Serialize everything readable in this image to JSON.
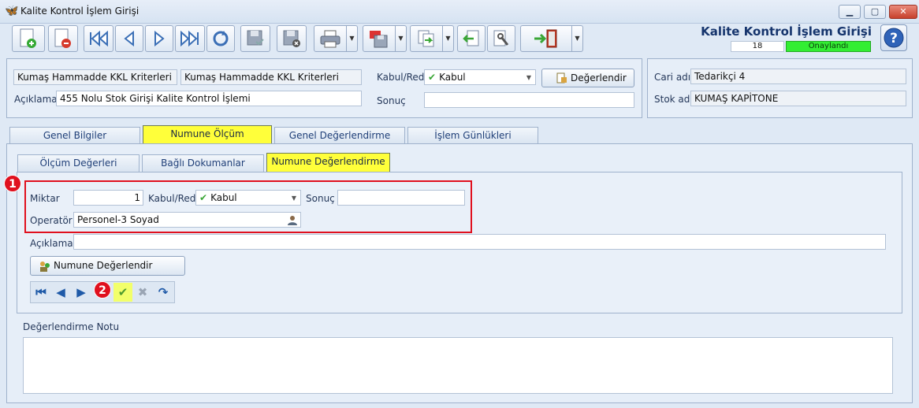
{
  "window": {
    "title": "Kalite Kontrol İşlem Girişi",
    "controls": {
      "minimize": "▁",
      "maximize": "▢",
      "close": "✕"
    }
  },
  "header": {
    "form_title": "Kalite Kontrol İşlem Girişi",
    "record_number": "18",
    "status": "Onaylandı",
    "help_label": "?"
  },
  "colors": {
    "active_tab": "#ffff3a",
    "status_badge": "#33ee33",
    "highlight_box": "#e0101e"
  },
  "top_panel": {
    "criteria_code": "Kumaş Hammadde KKL Kriterleri",
    "criteria_name": "Kumaş Hammadde KKL Kriterleri",
    "description_label": "Açıklama",
    "description_value": "455 Nolu Stok Girişi Kalite Kontrol İşlemi",
    "accept_reject_label": "Kabul/Red",
    "accept_reject_value": "Kabul",
    "evaluate_button": "Değerlendir",
    "result_label": "Sonuç",
    "result_value": ""
  },
  "right_panel": {
    "supplier_label": "Cari adı",
    "supplier_value": "Tedarikçi 4",
    "stock_label": "Stok adı",
    "stock_value": "KUMAŞ KAPİTONE"
  },
  "tabs": [
    {
      "label": "Genel Bilgiler"
    },
    {
      "label": "Numune Ölçüm"
    },
    {
      "label": "Genel Değerlendirme"
    },
    {
      "label": "İşlem Günlükleri"
    }
  ],
  "subtabs": [
    {
      "label": "Ölçüm Değerleri"
    },
    {
      "label": "Bağlı Dokumanlar"
    },
    {
      "label": "Numune Değerlendirme"
    }
  ],
  "sample_eval": {
    "quantity_label": "Miktar",
    "quantity_value": "1",
    "accept_reject_label": "Kabul/Red",
    "accept_reject_value": "Kabul",
    "result_label": "Sonuç",
    "result_value": "",
    "operator_label": "Operatör",
    "operator_value": "Personel-3 Soyad",
    "description_label": "Açıklama",
    "description_value": "",
    "evaluate_button": "Numune Değerlendir"
  },
  "markers": {
    "one": "1",
    "two": "2"
  },
  "notes": {
    "label": "Değerlendirme Notu",
    "value": ""
  }
}
